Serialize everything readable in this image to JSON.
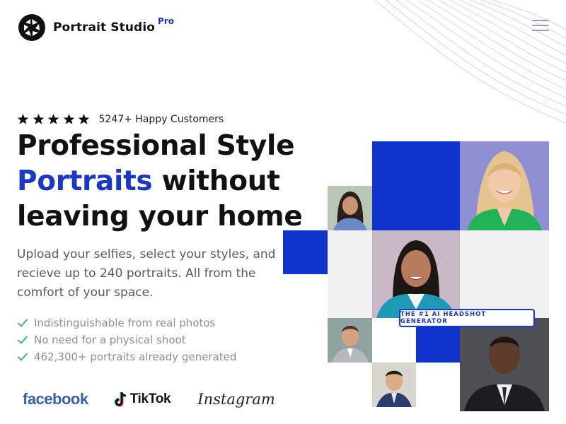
{
  "brand": {
    "name": "Portrait Studio",
    "tier": "Pro"
  },
  "rating": {
    "stars": 5,
    "text": "5247+ Happy Customers"
  },
  "headline": {
    "line1": "Professional Style",
    "accent": "Portraits",
    "line2_rest": "without",
    "line3": "leaving your home"
  },
  "description": "Upload your selfies, select your styles, and recieve up to 240 portraits. All from the comfort of your space.",
  "features": [
    "Indistinguishable from real photos",
    "No need for a physical shoot",
    "462,300+ portraits already generated"
  ],
  "socials": {
    "facebook": "facebook",
    "tiktok": "TikTok",
    "instagram": "Instagram"
  },
  "badge": "THE #1 AI HEADSHOT GENERATOR",
  "colors": {
    "accent": "#1a38c4",
    "tile_blue": "#0f33cc",
    "tile_grey": "#f1f1f3",
    "check_green": "#2bb673",
    "star": "#111111"
  },
  "icons": {
    "logo": "camera-aperture-icon",
    "menu": "hamburger-menu-icon",
    "star": "star-icon",
    "check": "checkmark-icon",
    "tiktok": "tiktok-note-icon"
  }
}
